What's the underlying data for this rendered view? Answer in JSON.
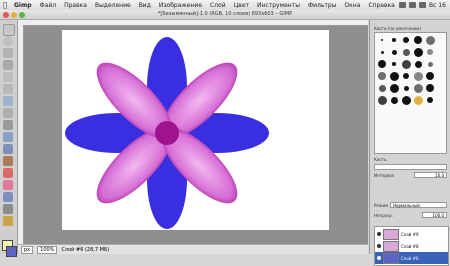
{
  "menubar": {
    "app": "Gimp",
    "items": [
      "Файл",
      "Правка",
      "Выделение",
      "Вид",
      "Изображение",
      "Слой",
      "Цвет",
      "Инструменты",
      "Фильтры",
      "Окна",
      "Справка"
    ],
    "clock": "Вс 16"
  },
  "window": {
    "title": "*[Безымянный]-1.0 (RGB, 10 слоев) 893x603 – GIMP"
  },
  "brushes": {
    "label": "Кисти (по умолчанию)"
  },
  "tool_options": {
    "label": "Кисть",
    "spacing_label": "Интервал",
    "spacing_value": "10.0"
  },
  "layers": {
    "mode_label": "Режим",
    "mode_value": "Нормальный",
    "opacity_label": "Непрозр.",
    "opacity_value": "100.0",
    "items": [
      {
        "name": "Слой #9",
        "selected": false
      },
      {
        "name": "Слой #8",
        "selected": false
      },
      {
        "name": "Слой #6",
        "selected": true
      }
    ]
  },
  "statusbar": {
    "unit": "px",
    "zoom": "100%",
    "info": "Слой #6 (28,7 МБ)"
  },
  "colors": {
    "petal_blue": "#3a2fe0",
    "petal_pink": "#d66fd6",
    "center": "#a0138f",
    "foreground": "#f3f7b0",
    "background": "#5b63c6"
  }
}
